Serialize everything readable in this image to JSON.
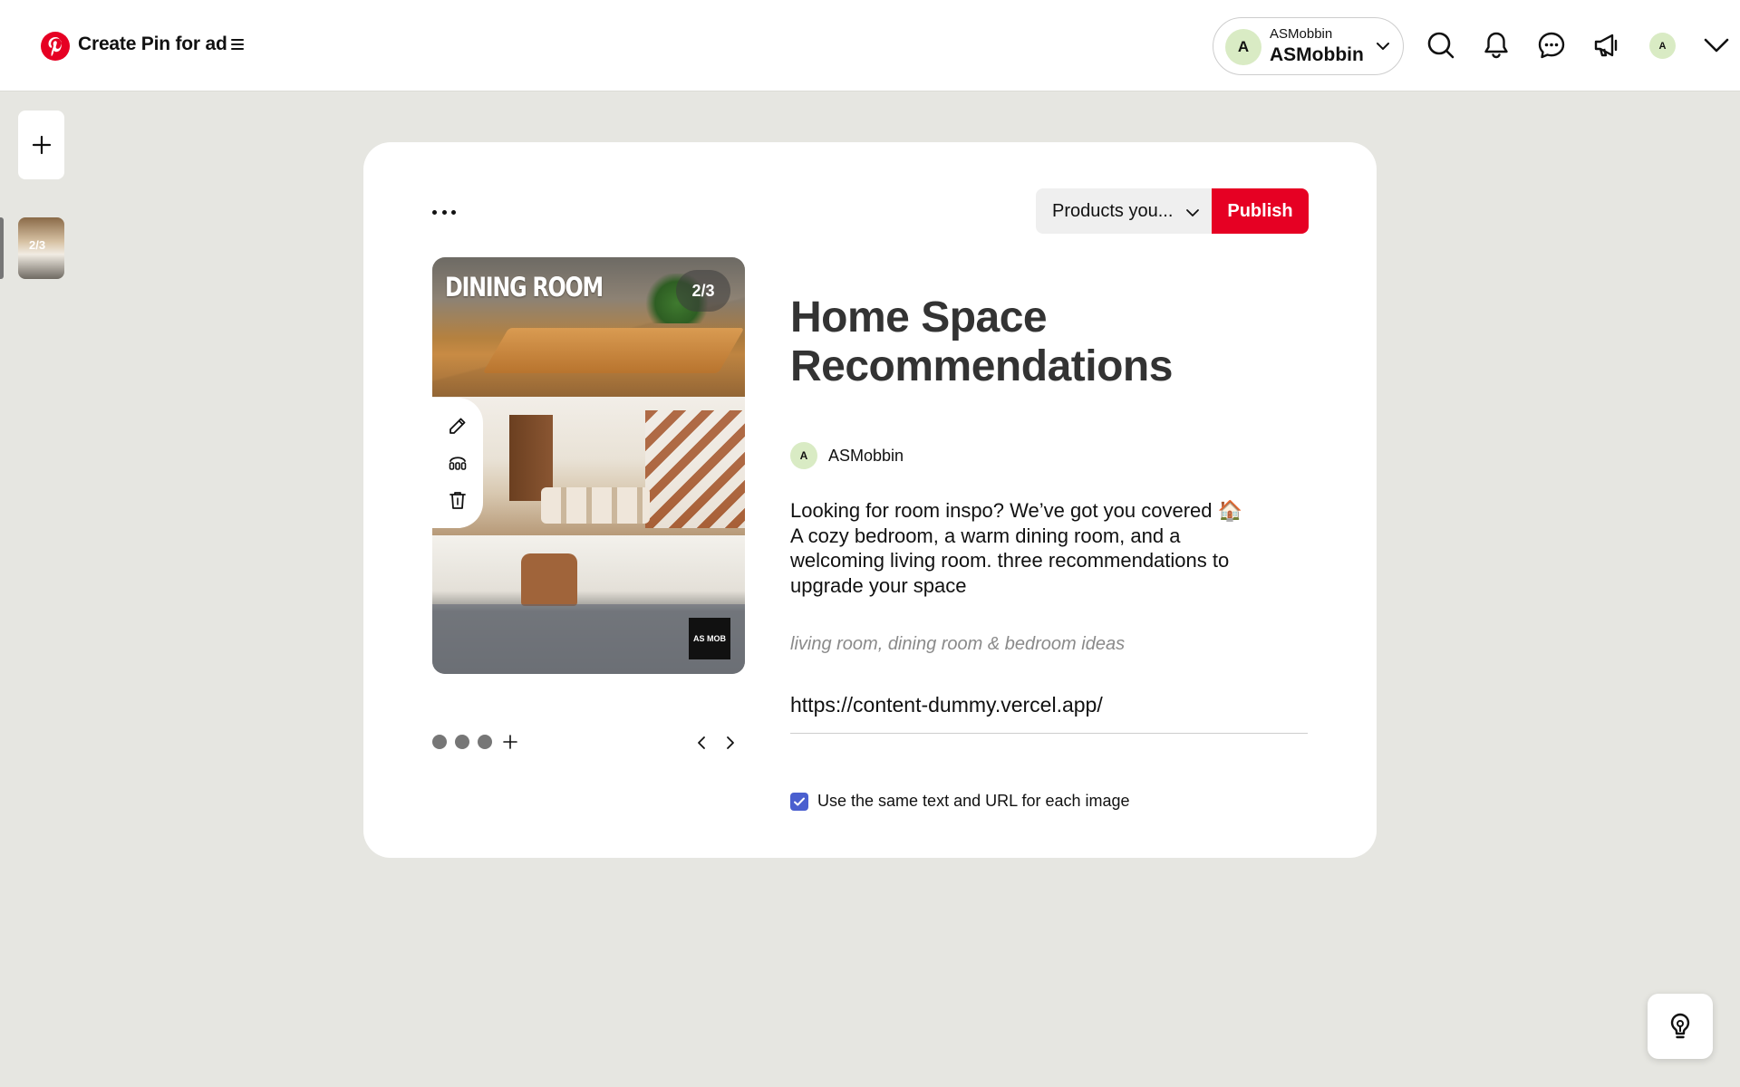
{
  "header": {
    "title": "Create Pin for ad",
    "account": {
      "avatar_initial": "A",
      "small_name": "ASMobbin",
      "name": "ASMobbin"
    },
    "user_avatar_initial": "A",
    "icons": [
      "pinterest-logo-icon",
      "menu-icon",
      "chevron-down-icon",
      "search-icon",
      "bell-icon",
      "messages-icon",
      "megaphone-icon",
      "chevron-down-icon"
    ]
  },
  "left_rail": {
    "thumbnail_label": "2/3"
  },
  "toolbar": {
    "products_select": "Products you...",
    "publish_label": "Publish"
  },
  "pin_preview": {
    "image_heading": "DINING ROOM",
    "page_indicator": "2/3",
    "brand_mark": "AS MOB",
    "tools": [
      "edit-icon",
      "adjust-icon",
      "trash-icon"
    ],
    "carousel_count": 3
  },
  "pin": {
    "title": "Home Space Recommendations",
    "author": {
      "initial": "A",
      "name": "ASMobbin"
    },
    "description_lines": [
      "Looking for room inspo? We’ve got you covered 🏠",
      "A cozy bedroom, a warm dining room, and a",
      "welcoming living room. three recommendations to",
      "upgrade your space"
    ],
    "alt_text": "living room, dining room & bedroom ideas",
    "url": "https://content-dummy.vercel.app/",
    "same_text_label": "Use the same text and URL for each image",
    "same_text_checked": true
  },
  "colors": {
    "brand_red": "#e60023",
    "checkbox_blue": "#4a5fcf",
    "canvas_bg": "#e6e6e1"
  }
}
